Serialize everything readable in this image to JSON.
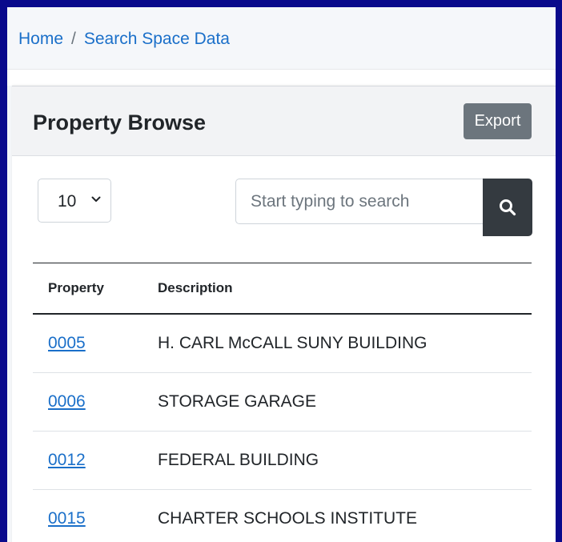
{
  "breadcrumb": {
    "home": "Home",
    "separator": "/",
    "current": "Search Space Data"
  },
  "card": {
    "title": "Property Browse",
    "export_label": "Export"
  },
  "controls": {
    "page_size": "10",
    "search_placeholder": "Start typing to search",
    "search_value": ""
  },
  "table": {
    "headers": {
      "property": "Property",
      "description": "Description"
    },
    "rows": [
      {
        "property": "0005",
        "description": "H. CARL McCALL SUNY BUILDING"
      },
      {
        "property": "0006",
        "description": "STORAGE GARAGE"
      },
      {
        "property": "0012",
        "description": "FEDERAL BUILDING"
      },
      {
        "property": "0015",
        "description": "CHARTER SCHOOLS INSTITUTE"
      }
    ]
  },
  "icons": {
    "search": "search-icon",
    "chevron": "chevron-down-icon"
  },
  "colors": {
    "frame": "#0a0a8c",
    "link": "#1a6fc9",
    "export_button": "#6c757d",
    "search_button": "#343a40"
  }
}
